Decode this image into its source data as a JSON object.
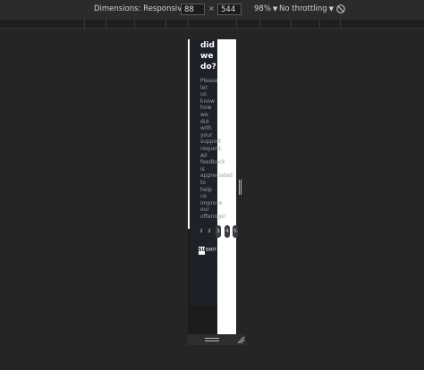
{
  "toolbar": {
    "dimensions_label": "Dimensions: Responsive",
    "width_value": "88",
    "times": "×",
    "height_value": "544",
    "zoom": "98%",
    "throttling": "No throttling"
  },
  "icons": {
    "caret": "caret-down-icon",
    "rotate": "rotate-icon",
    "resize": "resize-handle-icon"
  },
  "page": {
    "title": "did\nwe\ndo?",
    "body": "Please\nlet\nus\nknow\nhow\nwe\ndid\nwith\nyour\nsupport\nrequest.\nAll\nfeedback\nis\nappreciated\nto\nhelp\nus\nimprove\nour\nofferings!",
    "ratings": [
      "1",
      "2",
      "3",
      "4",
      "5"
    ],
    "submit_glyph": "SU",
    "submit_tail": "BMIT"
  },
  "colors": {
    "card": "#1f2129",
    "viewport": "#ffffff",
    "devtools_bg": "#252526"
  }
}
